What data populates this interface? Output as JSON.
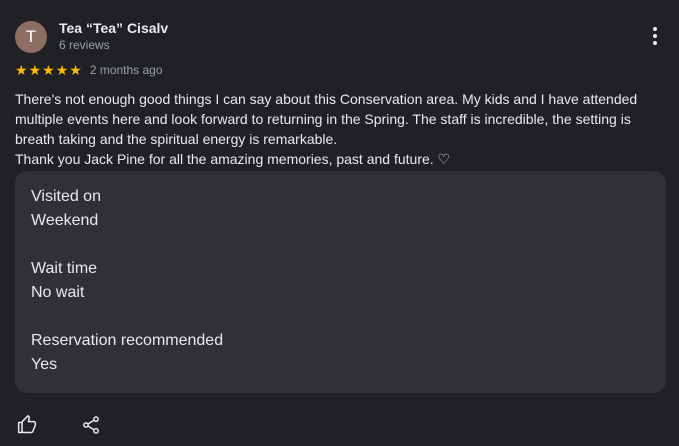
{
  "review": {
    "author": {
      "initial": "T",
      "name": "Tea “Tea” Cisalv",
      "review_count": "6 reviews",
      "avatar_color": "#8d6e63"
    },
    "rating": {
      "stars_display": "★★★★★",
      "value": 5,
      "max": 5,
      "star_color": "#fbbc04"
    },
    "date": "2 months ago",
    "text": {
      "line1": "There's not enough good things I can say about this Conservation area. My kids and I have attended multiple events here and look forward to returning in the Spring. The staff is incredible, the setting is breath taking and the spiritual energy is remarkable.",
      "line2": "Thank you Jack Pine for all the amazing memories, past and future. ♡"
    },
    "details": [
      {
        "label": "Visited on",
        "value": "Weekend"
      },
      {
        "label": "Wait time",
        "value": "No wait"
      },
      {
        "label": "Reservation recommended",
        "value": "Yes"
      }
    ],
    "icons": {
      "more": "more-vert-icon",
      "like": "thumb-up-icon",
      "share": "share-icon"
    },
    "colors": {
      "background": "#202124",
      "card": "#303134",
      "text": "#e8eaed",
      "muted": "#9aa0a6"
    }
  }
}
